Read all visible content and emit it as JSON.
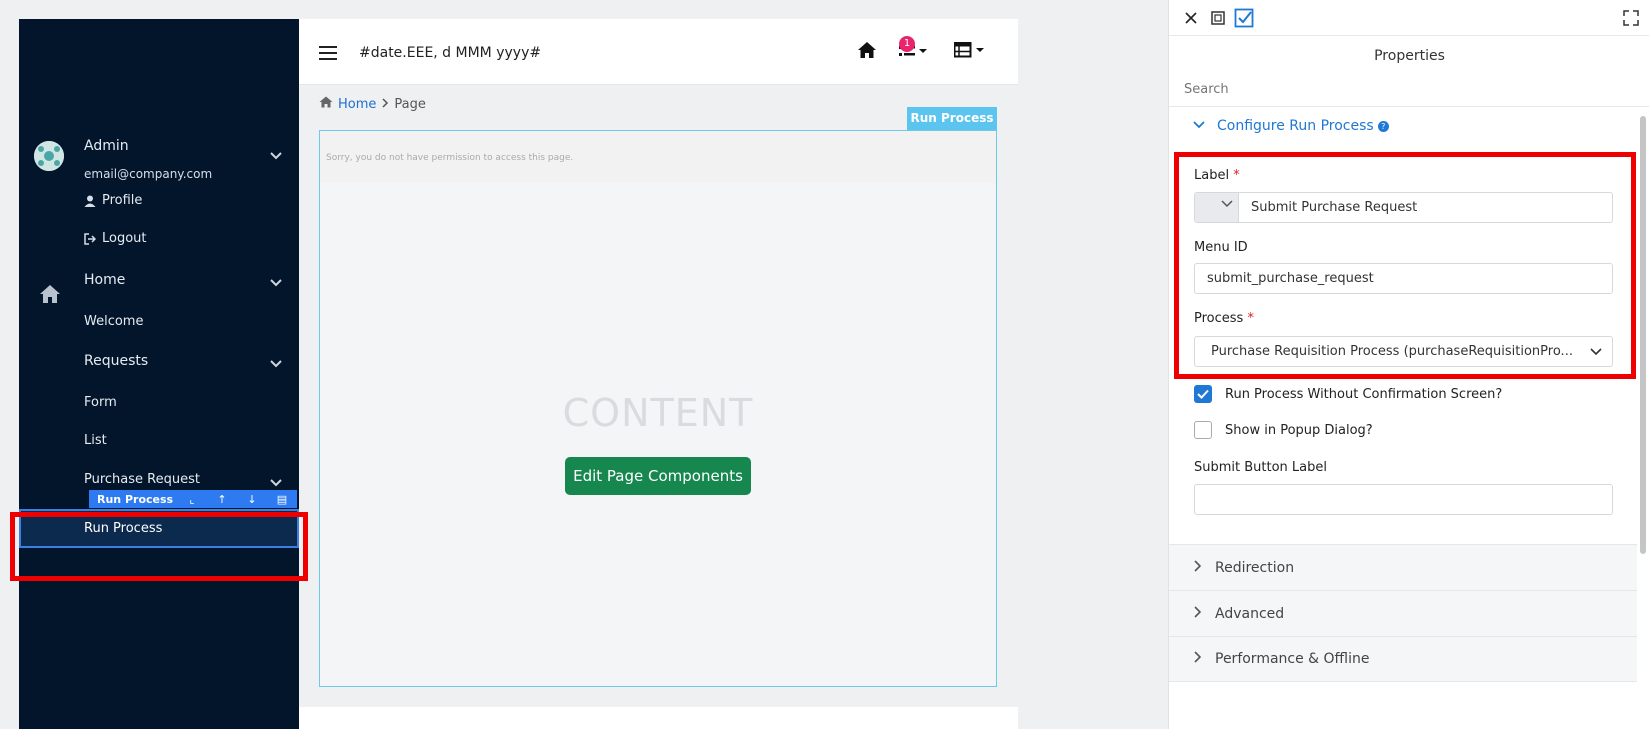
{
  "sidebar": {
    "user_name": "Admin",
    "user_email": "email@company.com",
    "profile": "Profile",
    "logout": "Logout",
    "home": "Home",
    "welcome": "Welcome",
    "requests": "Requests",
    "form": "Form",
    "list": "List",
    "purchase_request": "Purchase Request",
    "toolbar_label": "Run Process",
    "run_process": "Run Process"
  },
  "topbar": {
    "date_format": "#date.EEE, d MMM yyyy#",
    "notification_count": "1"
  },
  "breadcrumb": {
    "home": "Home",
    "page": "Page"
  },
  "content": {
    "permission_text": "Sorry, you do not have permission to access this page.",
    "placeholder": "CONTENT",
    "edit_button": "Edit Page Components",
    "element_tag": "Run Process"
  },
  "panel": {
    "title": "Properties",
    "search_placeholder": "Search",
    "section_title": "Configure Run Process",
    "help": "?",
    "label_label": "Label",
    "label_value": "Submit Purchase Request",
    "menu_id_label": "Menu ID",
    "menu_id_value": "submit_purchase_request",
    "process_label": "Process",
    "process_value": "Purchase Requisition Process (purchaseRequisitionPro...",
    "required_mark": "*",
    "checkbox_no_confirm": "Run Process Without Confirmation Screen?",
    "checkbox_no_confirm_checked": true,
    "checkbox_popup": "Show in Popup Dialog?",
    "checkbox_popup_checked": false,
    "submit_label_label": "Submit Button Label",
    "submit_label_value": "",
    "accordions": [
      "Redirection",
      "Advanced",
      "Performance & Offline"
    ]
  },
  "colors": {
    "sidebar_bg": "#03152b",
    "accent": "#1e78d4",
    "edit_button": "#16874f",
    "highlight": "#ee0000",
    "badge": "#e8246d"
  }
}
